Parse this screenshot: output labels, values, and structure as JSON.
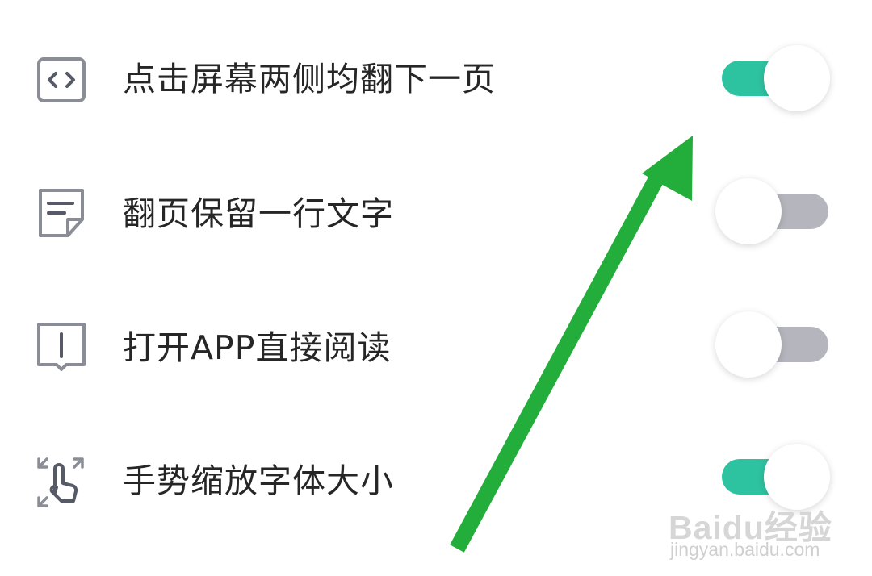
{
  "settings": [
    {
      "label": "点击屏幕两侧均翻下一页",
      "icon": "code-brackets-icon",
      "enabled": true
    },
    {
      "label": "翻页保留一行文字",
      "icon": "note-page-icon",
      "enabled": false
    },
    {
      "label": "打开APP直接阅读",
      "icon": "open-book-icon",
      "enabled": false
    },
    {
      "label": "手势缩放字体大小",
      "icon": "pinch-zoom-gesture-icon",
      "enabled": true
    }
  ],
  "colors": {
    "toggle_on": "#2ec3a0",
    "toggle_off": "#b5b6bd",
    "icon_stroke": "#8a8d96",
    "arrow": "#23ad3b"
  },
  "watermark": {
    "logo_text": "Baidu经验",
    "url": "jingyan.baidu.com"
  }
}
